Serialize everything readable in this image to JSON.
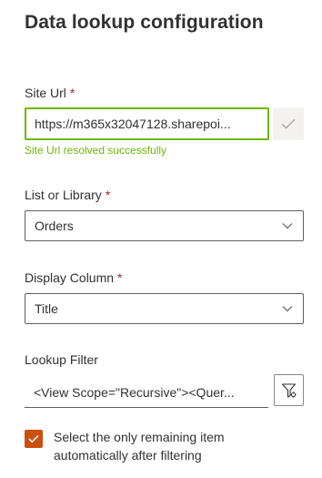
{
  "panel": {
    "title": "Data lookup configuration"
  },
  "site_url": {
    "label": "Site Url",
    "required_mark": "*",
    "value": "https://m365x32047128.sharepoi...",
    "validate_icon": "checkmark-icon",
    "status": "Site Url resolved successfully",
    "status_color": "#6bb700"
  },
  "list_or_library": {
    "label": "List or Library",
    "required_mark": "*",
    "selected": "Orders",
    "icon": "chevron-down-icon"
  },
  "display_column": {
    "label": "Display Column",
    "required_mark": "*",
    "selected": "Title",
    "icon": "chevron-down-icon"
  },
  "lookup_filter": {
    "label": "Lookup Filter",
    "value": "<View Scope=\"Recursive\"><Quer...",
    "button_icon": "filter-settings-icon"
  },
  "auto_select": {
    "checked": true,
    "label": "Select the only remaining item automatically after filtering",
    "accent_color": "#ca5010"
  },
  "colors": {
    "required": "#a4262c",
    "success_border": "#6bb700",
    "text": "#323130"
  }
}
